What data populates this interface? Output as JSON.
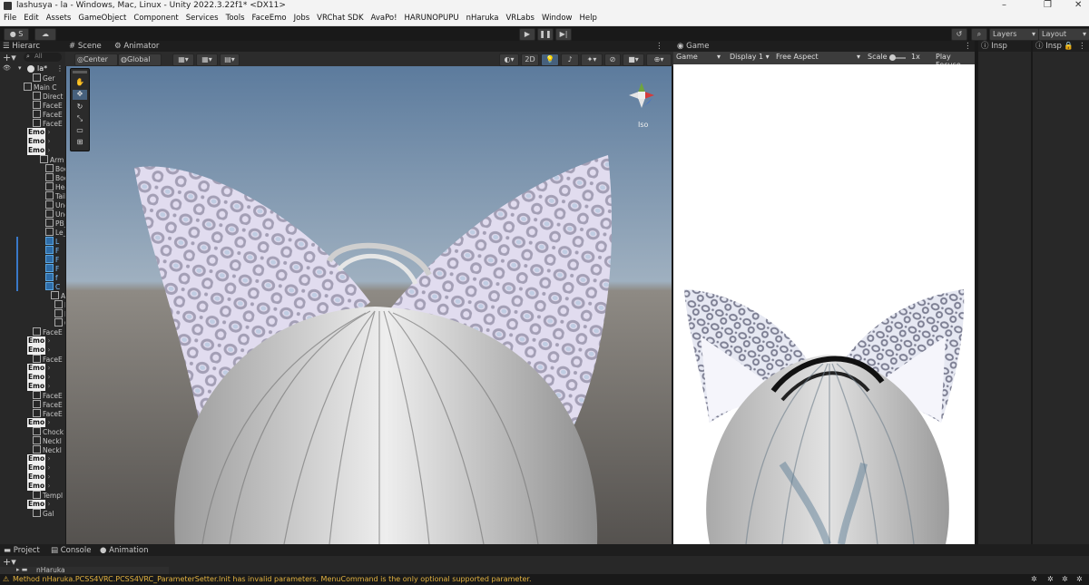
{
  "window": {
    "title": "lashusya - la - Windows, Mac, Linux - Unity 2022.3.22f1* <DX11>",
    "controls": [
      "–",
      "❐",
      "✕"
    ]
  },
  "menu": [
    "File",
    "Edit",
    "Assets",
    "GameObject",
    "Component",
    "Services",
    "Tools",
    "FaceEmo",
    "Jobs",
    "VRChat SDK",
    "AvaPo!",
    "HARUNOPUPU",
    "nHaruka",
    "VRLabs",
    "Window",
    "Help"
  ],
  "toolbar": {
    "account": "S",
    "layers": "Layers",
    "layout": "Layout"
  },
  "hierarchy": {
    "tab": "Hierarc",
    "search": "All",
    "root": "la*",
    "rows": [
      {
        "label": "Ger",
        "emo": false,
        "blue": false
      },
      {
        "label": "Main C",
        "emo": false,
        "blue": false
      },
      {
        "label": "Direct",
        "emo": false,
        "blue": false
      },
      {
        "label": "FaceE",
        "emo": false,
        "blue": false
      },
      {
        "label": "FaceE",
        "emo": false,
        "blue": false
      },
      {
        "label": "FaceE",
        "emo": false,
        "blue": false
      },
      {
        "label": "Emo",
        "emo": true,
        "blue": false
      },
      {
        "label": "Emo",
        "emo": true,
        "blue": false
      },
      {
        "label": "Emo",
        "emo": true,
        "blue": false
      },
      {
        "label": "Arm",
        "emo": false,
        "blue": false
      },
      {
        "label": "Bod",
        "emo": false,
        "blue": false
      },
      {
        "label": "Bod",
        "emo": false,
        "blue": false
      },
      {
        "label": "Hea",
        "emo": false,
        "blue": false
      },
      {
        "label": "Tail",
        "emo": false,
        "blue": false
      },
      {
        "label": "Und",
        "emo": false,
        "blue": false
      },
      {
        "label": "Und",
        "emo": false,
        "blue": false
      },
      {
        "label": "PB_",
        "emo": false,
        "blue": false
      },
      {
        "label": "Le_",
        "emo": false,
        "blue": false
      },
      {
        "label": "L",
        "emo": false,
        "blue": true
      },
      {
        "label": "F",
        "emo": false,
        "blue": true
      },
      {
        "label": "F",
        "emo": false,
        "blue": true
      },
      {
        "label": "F",
        "emo": false,
        "blue": true
      },
      {
        "label": "f",
        "emo": false,
        "blue": true
      },
      {
        "label": "C",
        "emo": false,
        "blue": true
      },
      {
        "label": "A",
        "emo": false,
        "blue": false
      },
      {
        "label": "E",
        "emo": false,
        "blue": false
      },
      {
        "label": "E",
        "emo": false,
        "blue": false
      },
      {
        "label": "C",
        "emo": false,
        "blue": false
      },
      {
        "label": "FaceE",
        "emo": false,
        "blue": false
      },
      {
        "label": "Emo",
        "emo": true,
        "blue": false
      },
      {
        "label": "Emo",
        "emo": true,
        "blue": false
      },
      {
        "label": "FaceE",
        "emo": false,
        "blue": false
      },
      {
        "label": "Emo",
        "emo": true,
        "blue": false
      },
      {
        "label": "Emo",
        "emo": true,
        "blue": false
      },
      {
        "label": "Emo",
        "emo": true,
        "blue": false
      },
      {
        "label": "FaceE",
        "emo": false,
        "blue": false
      },
      {
        "label": "FaceE",
        "emo": false,
        "blue": false
      },
      {
        "label": "FaceE",
        "emo": false,
        "blue": false
      },
      {
        "label": "Emo",
        "emo": true,
        "blue": false
      },
      {
        "label": "Chock",
        "emo": false,
        "blue": false
      },
      {
        "label": "Neckl",
        "emo": false,
        "blue": false
      },
      {
        "label": "Neckl",
        "emo": false,
        "blue": false
      },
      {
        "label": "Emo",
        "emo": true,
        "blue": false
      },
      {
        "label": "Emo",
        "emo": true,
        "blue": false
      },
      {
        "label": "Emo",
        "emo": true,
        "blue": false
      },
      {
        "label": "Emo",
        "emo": true,
        "blue": false
      },
      {
        "label": "Templ",
        "emo": false,
        "blue": false
      },
      {
        "label": "Emo",
        "emo": true,
        "blue": false
      },
      {
        "label": "Gal",
        "emo": false,
        "blue": false
      }
    ]
  },
  "scene": {
    "tabs": [
      "Scene",
      "Animator"
    ],
    "pivot": "Center",
    "space": "Global",
    "mode2d": "2D",
    "gizmo_label": "Iso"
  },
  "game": {
    "tab": "Game",
    "mode": "Game",
    "display": "Display 1",
    "aspect": "Free Aspect",
    "scale_label": "Scale",
    "scale_value": "1x",
    "play_focused": "Play Focuse"
  },
  "inspectors": [
    "Insp",
    "Insp"
  ],
  "bottom": {
    "tabs": [
      "Project",
      "Console",
      "Animation"
    ],
    "folder": "nHaruka"
  },
  "status": {
    "message": "Method nHaruka.PCSS4VRC.PCSS4VRC_ParameterSetter.Init has invalid parameters. MenuCommand is the only optional supported parameter."
  }
}
